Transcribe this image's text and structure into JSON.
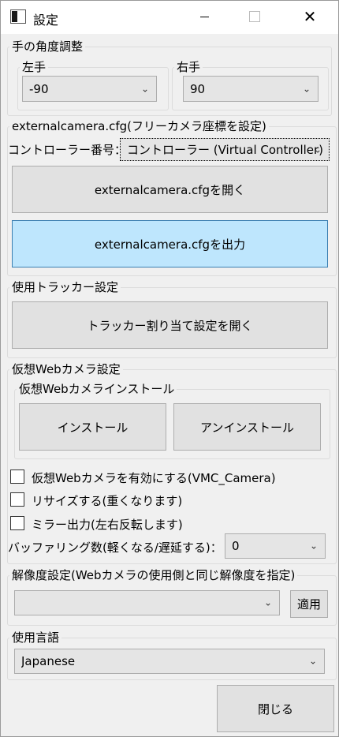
{
  "window": {
    "title": "設定",
    "icon": "app-window-icon"
  },
  "hand_angle": {
    "group_title": "手の角度調整",
    "left": {
      "label": "左手",
      "value": "-90"
    },
    "right": {
      "label": "右手",
      "value": "90"
    }
  },
  "external_camera": {
    "group_title": "externalcamera.cfg(フリーカメラ座標を設定)",
    "controller_label": "コントローラー番号：",
    "controller_value": "コントローラー (Virtual Controller)",
    "open_button": "externalcamera.cfgを開く",
    "export_button": "externalcamera.cfgを出力"
  },
  "tracker": {
    "group_title": "使用トラッカー設定",
    "open_button": "トラッカー割り当て設定を開く"
  },
  "webcam": {
    "group_title": "仮想Webカメラ設定",
    "install_group_title": "仮想Webカメラインストール",
    "install_button": "インストール",
    "uninstall_button": "アンインストール",
    "enable_label": "仮想Webカメラを有効にする(VMC_Camera)",
    "resize_label": "リサイズする(重くなります)",
    "mirror_label": "ミラー出力(左右反転します)",
    "buffering_label": "バッファリング数(軽くなる/遅延する)：",
    "buffering_value": "0"
  },
  "resolution": {
    "group_title": "解像度設定(Webカメラの使用側と同じ解像度を指定)",
    "value": "",
    "apply_button": "適用"
  },
  "language": {
    "group_title": "使用言語",
    "value": "Japanese"
  },
  "close_button": "閉じる"
}
